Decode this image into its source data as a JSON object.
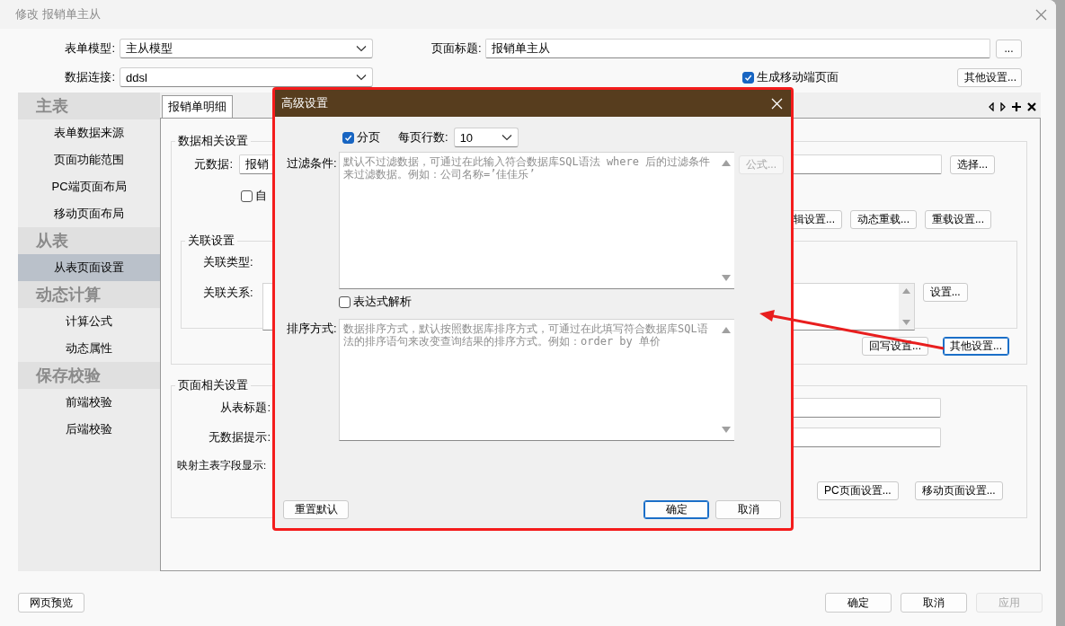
{
  "window": {
    "title": "修改 报销单主从"
  },
  "form": {
    "model_label": "表单模型:",
    "model_value": "主从模型",
    "title_label": "页面标题:",
    "title_value": "报销单主从",
    "title_button": "...",
    "connection_label": "数据连接:",
    "connection_value": "ddsl",
    "mobile_page": {
      "label": "生成移动端页面",
      "checked": true
    },
    "other_settings_button": "其他设置..."
  },
  "sidebar": {
    "groups": [
      {
        "title": "主表",
        "items": [
          {
            "label": "表单数据来源",
            "selected": false
          },
          {
            "label": "页面功能范围",
            "selected": false
          },
          {
            "label": "PC端页面布局",
            "selected": false
          },
          {
            "label": "移动页面布局",
            "selected": false
          }
        ]
      },
      {
        "title": "从表",
        "items": [
          {
            "label": "从表页面设置",
            "selected": true
          }
        ]
      },
      {
        "title": "动态计算",
        "items": [
          {
            "label": "计算公式",
            "selected": false
          },
          {
            "label": "动态属性",
            "selected": false
          }
        ]
      },
      {
        "title": "保存校验",
        "items": [
          {
            "label": "前端校验",
            "selected": false
          },
          {
            "label": "后端校验",
            "selected": false
          }
        ]
      }
    ]
  },
  "tabs": [
    {
      "label": "报销单明细",
      "selected": true
    }
  ],
  "data_settings": {
    "title": "数据相关设置",
    "metadata_label": "元数据:",
    "metadata_value": "报销",
    "select_button": "选择...",
    "auto_checkbox": {
      "label": "自",
      "checked": false
    },
    "buttons": [
      "辑设置...",
      "动态重载...",
      "重载设置..."
    ],
    "relation": {
      "title": "关联设置",
      "type_label": "关联类型:",
      "relation_label": "关联关系:",
      "settings_button": "设置..."
    },
    "bottom_buttons": [
      {
        "label": "回写设置...",
        "focused": false
      },
      {
        "label": "其他设置...",
        "focused": true
      }
    ]
  },
  "page_settings": {
    "title": "页面相关设置",
    "fields": [
      "从表标题:",
      "无数据提示:"
    ],
    "mapping_label": "映射主表字段显示:",
    "buttons": [
      "PC页面设置...",
      "移动页面设置..."
    ]
  },
  "footer": {
    "preview_button": "网页预览",
    "buttons": [
      {
        "label": "确定",
        "disabled": false
      },
      {
        "label": "取消",
        "disabled": false
      },
      {
        "label": "应用",
        "disabled": true
      }
    ]
  },
  "dialog": {
    "title": "高级设置",
    "paging": {
      "label": "分页",
      "checked": true
    },
    "rows_label": "每页行数:",
    "rows_value": "10",
    "filter": {
      "label": "过滤条件:",
      "placeholder": "默认不过滤数据，可通过在此输入符合数据库SQL语法 where 后的过滤条件来过滤数据。例如：公司名称=’佳佳乐’",
      "formula_button": {
        "label": "公式...",
        "disabled": true
      }
    },
    "expression": {
      "label": "表达式解析",
      "checked": false
    },
    "sort": {
      "label": "排序方式:",
      "placeholder": "数据排序方式，默认按照数据库排序方式，可通过在此填写符合数据库SQL语法的排序语句来改变查询结果的排序方式。例如：order by 单价"
    },
    "reset_button": "重置默认",
    "buttons": [
      {
        "label": "确定",
        "focused": true
      },
      {
        "label": "取消",
        "focused": false
      }
    ]
  }
}
